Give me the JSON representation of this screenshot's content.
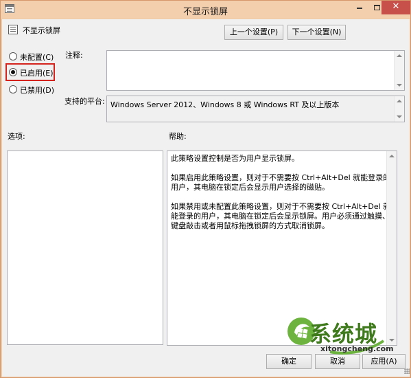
{
  "window": {
    "title": "不显示锁屏",
    "minimize": "–",
    "maximize": "□",
    "close": "✕"
  },
  "header": {
    "setting_name": "不显示锁屏",
    "prev_button": "上一个设置(P)",
    "next_button": "下一个设置(N)"
  },
  "state": {
    "options": [
      {
        "label": "未配置(C)",
        "checked": false
      },
      {
        "label": "已启用(E)",
        "checked": true
      },
      {
        "label": "已禁用(D)",
        "checked": false
      }
    ],
    "highlight_color": "#d3231c"
  },
  "comment": {
    "label": "注释:",
    "value": ""
  },
  "platform": {
    "label": "支持的平台:",
    "value": "Windows Server 2012、Windows 8 或 Windows RT 及以上版本"
  },
  "options_section": {
    "label": "选项:"
  },
  "help_section": {
    "label": "帮助:",
    "paragraphs": [
      "此策略设置控制是否为用户显示锁屏。",
      "如果启用此策略设置，则对于不需要按 Ctrl+Alt+Del 就能登录的用户，其电脑在锁定后会显示用户选择的磁贴。",
      "如果禁用或未配置此策略设置，则对于不需要按 Ctrl+Alt+Del 就能登录的用户，其电脑在锁定后会显示锁屏。用户必须通过触摸、键盘敲击或者用鼠标拖拽锁屏的方式取消锁屏。"
    ]
  },
  "footer": {
    "ok": "确定",
    "cancel": "取消",
    "apply": "应用(A)"
  },
  "watermark": {
    "text": "系统城",
    "url": "xitongcheng.com"
  }
}
